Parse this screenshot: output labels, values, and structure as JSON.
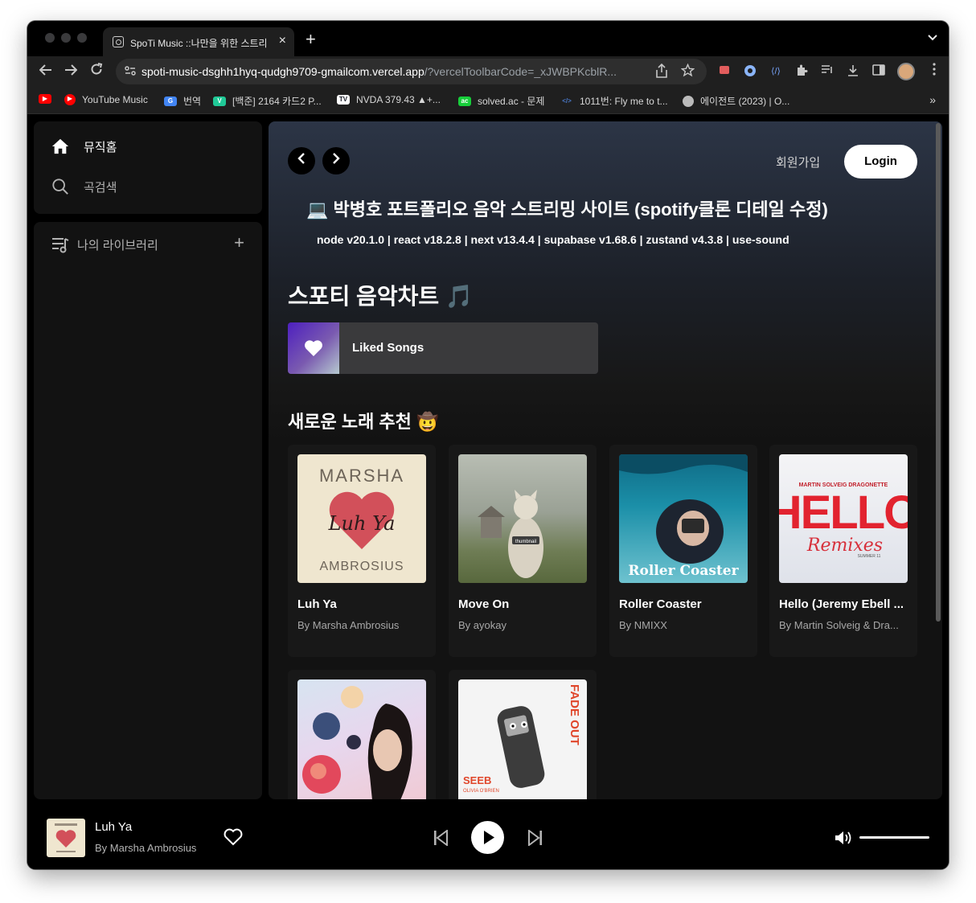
{
  "browser": {
    "tab_title": "SpoTi Music ::나만을 위한 스트리밍",
    "tab_close": "×",
    "new_tab": "+",
    "url_main": "spoti-music-dsghh1hyq-qudgh9709-gmailcom.vercel.app",
    "url_rest": "/?vercelToolbarCode=_xJWBPKcblR...",
    "bookmarks": [
      {
        "label": "YouTube Music",
        "icon": "youtube-music-icon",
        "color": "#ff0000"
      },
      {
        "label": "번역",
        "icon": "google-translate-icon",
        "color": "#4285f4"
      },
      {
        "label": "[백준] 2164 카드2 P...",
        "icon": "velog-icon",
        "color": "#20c997"
      },
      {
        "label": "NVDA 379.43 ▲+...",
        "icon": "tradingview-icon",
        "color": "#131722"
      },
      {
        "label": "solved.ac - 문제",
        "icon": "solvedac-icon",
        "color": "#17ce3a"
      },
      {
        "label": "1011번: Fly me to t...",
        "icon": "code-icon",
        "color": "#1f1f1f"
      },
      {
        "label": "에이전트 (2023) | O...",
        "icon": "globe-icon",
        "color": "#1f1f1f"
      }
    ],
    "bookmarks_more": "»"
  },
  "sidebar": {
    "home_label": "뮤직홈",
    "search_label": "곡검색",
    "library_label": "나의 라이브러리",
    "library_add": "+"
  },
  "header": {
    "signup_label": "회원가입",
    "login_label": "Login"
  },
  "hero": {
    "title": "💻 박병호 포트폴리오 음악 스트리밍 사이트 (spotify클론 디테일 수정)",
    "stack": "node v20.1.0 | react v18.2.8 | next v13.4.4 | supabase v1.68.6 | zustand v4.3.8 | use-sound"
  },
  "chart_section": {
    "title": "스포티 음악차트",
    "emoji": "🎵",
    "liked_songs_label": "Liked Songs"
  },
  "new_section": {
    "title": "새로운 노래 추천 🤠",
    "songs": [
      {
        "title": "Luh Ya",
        "artist": "By Marsha Ambrosius"
      },
      {
        "title": "Move On",
        "artist": "By ayokay"
      },
      {
        "title": "Roller Coaster",
        "artist": "By NMIXX"
      },
      {
        "title": "Hello (Jeremy Ebell ...",
        "artist": "By Martin Solveig & Dra..."
      },
      {
        "title": "",
        "artist": ""
      },
      {
        "title": "",
        "artist": ""
      }
    ],
    "cover_text": {
      "luh_ya_top": "MARSHA",
      "luh_ya_mid": "Luh Ya",
      "luh_ya_bottom": "AMBROSIUS",
      "move_on_tag": "thumbnail",
      "roller_coaster": "Roller Coaster",
      "hello_artists": "MARTIN SOLVEIG DRAGONETTE",
      "hello_big": "HELLO",
      "hello_sub": "Remixes",
      "hello_small": "SUMMER 11",
      "fade_out": "FADE OUT",
      "seeb": "SEEB",
      "seeb_feat": "OLIVIA O'BRIEN"
    }
  },
  "player": {
    "now_playing_title": "Luh Ya",
    "now_playing_artist": "By Marsha Ambrosius",
    "volume": 1.0
  },
  "colors": {
    "accent": "#ffffff",
    "background": "#121212",
    "card": "#181818",
    "liked_gradient_start": "#4d1fbf"
  }
}
